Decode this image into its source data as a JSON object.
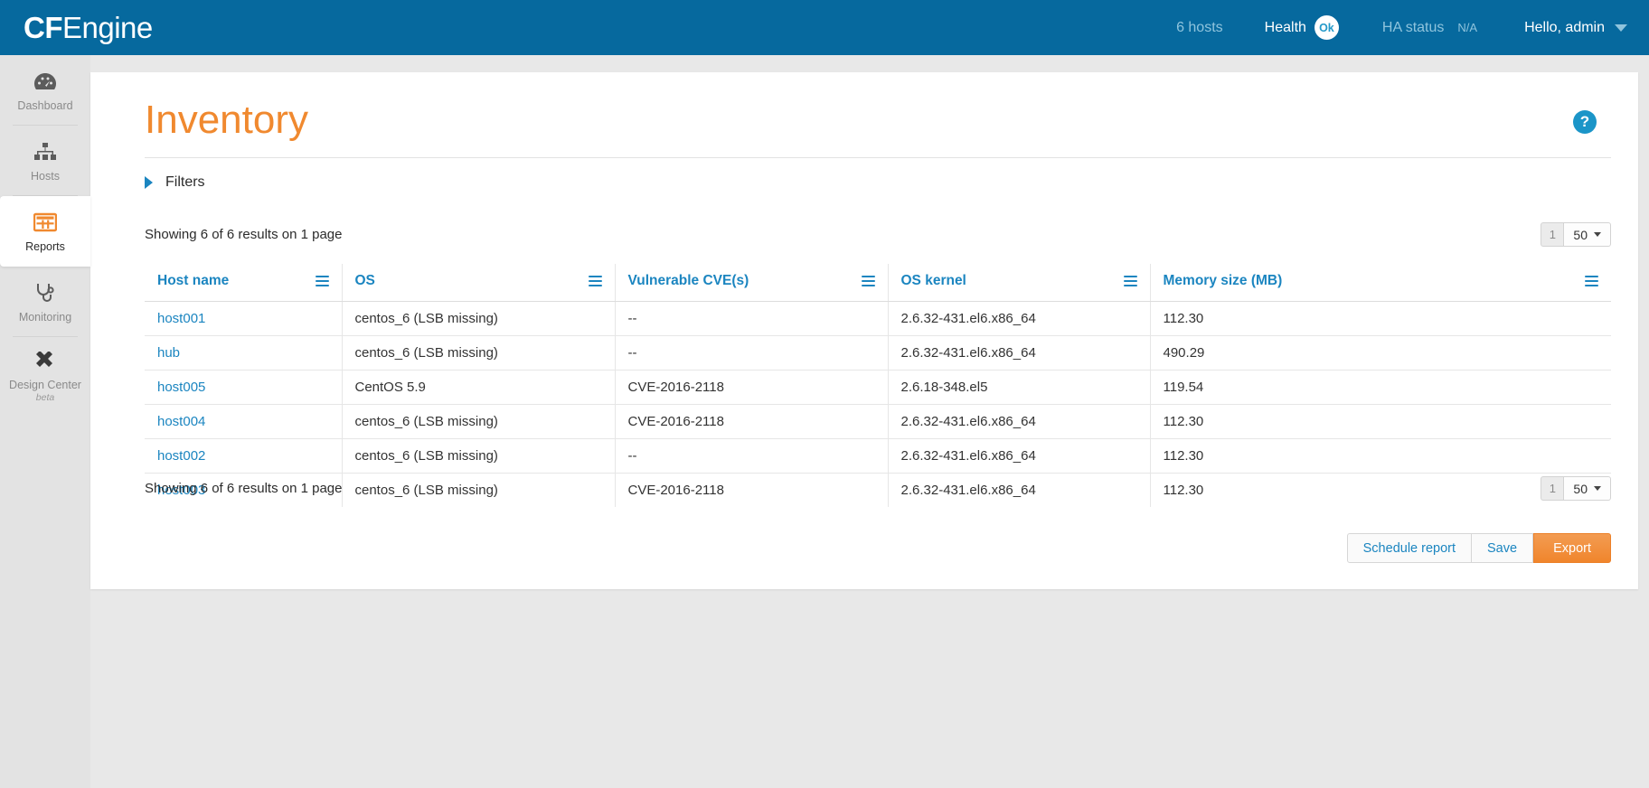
{
  "header": {
    "logo_cf": "CF",
    "logo_engine": "Engine",
    "host_count": "6 hosts",
    "health_label": "Health",
    "health_status": "Ok",
    "ha_label": "HA status",
    "ha_value": "N/A",
    "user_greeting": "Hello, admin"
  },
  "sidebar": {
    "items": [
      {
        "label": "Dashboard",
        "icon": "dashboard-gauge-icon",
        "active": false
      },
      {
        "label": "Hosts",
        "icon": "hosts-hierarchy-icon",
        "active": false
      },
      {
        "label": "Reports",
        "icon": "reports-grid-icon",
        "active": true
      },
      {
        "label": "Monitoring",
        "icon": "stethoscope-icon",
        "active": false
      },
      {
        "label": "Design Center",
        "sub": "beta",
        "icon": "design-center-icon",
        "active": false
      }
    ]
  },
  "page": {
    "title": "Inventory",
    "help_icon": "question-mark-help-icon",
    "filters_label": "Filters",
    "filters_chevron": "chevron-right-icon"
  },
  "results": {
    "summary_top": "Showing 6 of 6 results on 1 page",
    "summary_bottom": "Showing 6 of 6 results on 1 page",
    "page_number": "1",
    "page_size": "50"
  },
  "table": {
    "columns": [
      {
        "label": "Host name",
        "menu_icon": "column-menu-icon"
      },
      {
        "label": "OS",
        "menu_icon": "column-menu-icon"
      },
      {
        "label": "Vulnerable CVE(s)",
        "menu_icon": "column-menu-icon"
      },
      {
        "label": "OS kernel",
        "menu_icon": "column-menu-icon"
      },
      {
        "label": "Memory size (MB)",
        "menu_icon": "column-menu-icon"
      }
    ],
    "rows": [
      {
        "host": "host001",
        "os": "centos_6 (LSB missing)",
        "cve": "--",
        "kernel": "2.6.32-431.el6.x86_64",
        "memory": "112.30"
      },
      {
        "host": "hub",
        "os": "centos_6 (LSB missing)",
        "cve": "--",
        "kernel": "2.6.32-431.el6.x86_64",
        "memory": "490.29"
      },
      {
        "host": "host005",
        "os": "CentOS 5.9",
        "cve": "CVE-2016-2118",
        "kernel": "2.6.18-348.el5",
        "memory": "119.54"
      },
      {
        "host": "host004",
        "os": "centos_6 (LSB missing)",
        "cve": "CVE-2016-2118",
        "kernel": "2.6.32-431.el6.x86_64",
        "memory": "112.30"
      },
      {
        "host": "host002",
        "os": "centos_6 (LSB missing)",
        "cve": "--",
        "kernel": "2.6.32-431.el6.x86_64",
        "memory": "112.30"
      },
      {
        "host": "host003",
        "os": "centos_6 (LSB missing)",
        "cve": "CVE-2016-2118",
        "kernel": "2.6.32-431.el6.x86_64",
        "memory": "112.30"
      }
    ]
  },
  "actions": {
    "schedule_report": "Schedule report",
    "save": "Save",
    "export": "Export"
  },
  "colors": {
    "header_blue": "#06699e",
    "link_blue": "#1b85c0",
    "accent_orange": "#f0892f",
    "export_orange": "#f0852c",
    "sidebar_gray": "#e3e3e3"
  }
}
